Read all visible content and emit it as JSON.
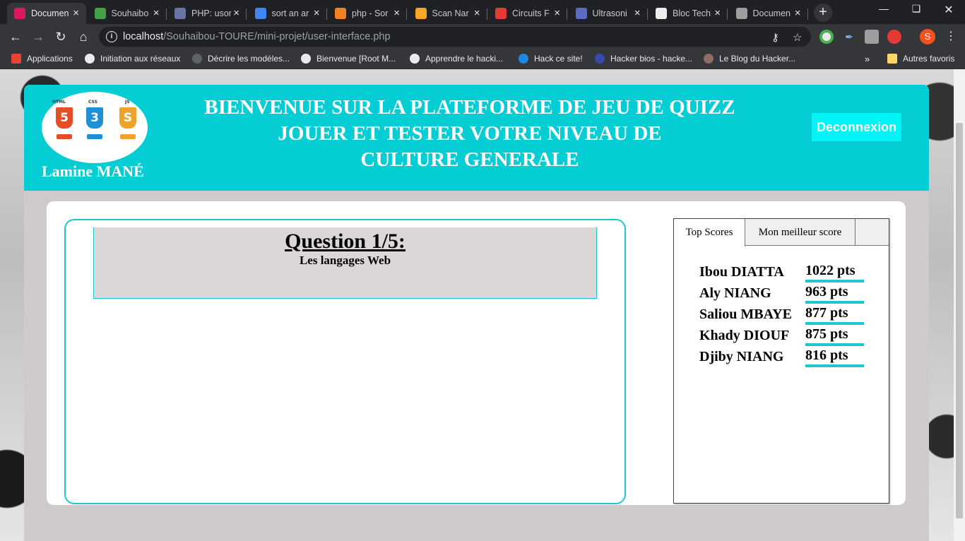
{
  "browser": {
    "tabs": [
      {
        "title": "Documen",
        "color": "#d81b60",
        "active": true
      },
      {
        "title": "Souhaibo",
        "color": "#43a047",
        "active": false
      },
      {
        "title": "PHP: usor",
        "color": "#6a74a7",
        "active": false
      },
      {
        "title": "sort an ar",
        "color": "#4285f4",
        "active": false
      },
      {
        "title": "php - Sor",
        "color": "#f48024",
        "active": false
      },
      {
        "title": "Scan Nar",
        "color": "#f9a825",
        "active": false
      },
      {
        "title": "Circuits F",
        "color": "#e53935",
        "active": false
      },
      {
        "title": "Ultrasoni",
        "color": "#5c6bc0",
        "active": false
      },
      {
        "title": "Bloc Tech",
        "color": "#eeeeee",
        "active": false
      },
      {
        "title": "Documen",
        "color": "#9e9e9e",
        "active": false
      }
    ],
    "url_host": "localhost",
    "url_path": "/Souhaibou-TOURE/mini-projet/user-interface.php",
    "profile_initial": "S",
    "bookmarks": [
      {
        "label": "Applications",
        "color": "#ea4335"
      },
      {
        "label": "Initiation aux réseaux",
        "color": "#e8eaed"
      },
      {
        "label": "Décrire les modèles...",
        "color": "#5f6368"
      },
      {
        "label": "Bienvenue [Root M...",
        "color": "#e8eaed"
      },
      {
        "label": "Apprendre le hacki...",
        "color": "#e8eaed"
      },
      {
        "label": "Hack ce site!",
        "color": "#1e88e5"
      },
      {
        "label": "Hacker bios - hacke...",
        "color": "#3949ab"
      },
      {
        "label": "Le Blog du Hacker...",
        "color": "#8d6e63"
      }
    ],
    "other_bookmarks": "Autres favoris"
  },
  "header": {
    "user_name": "Lamine MANÉ",
    "welcome_line1": "BIENVENUE SUR LA PLATEFORME DE JEU DE QUIZZ",
    "welcome_line2": "JOUER ET TESTER VOTRE NIVEAU DE CULTURE GENERALE",
    "logout_label": "Deconnexion",
    "logo_labels": [
      "HTML",
      "CSS",
      "JS"
    ],
    "logo_glyphs": [
      "5",
      "3",
      "S"
    ],
    "accent_color": "#04cdd3"
  },
  "question": {
    "title": "Question 1/5:",
    "topic": "Les langages Web"
  },
  "scores": {
    "tab_top": "Top Scores",
    "tab_mine": "Mon meilleur score",
    "top": [
      {
        "name": "Ibou DIATTA",
        "points": "1022 pts"
      },
      {
        "name": "Aly NIANG",
        "points": "963 pts"
      },
      {
        "name": "Saliou MBAYE",
        "points": "877 pts"
      },
      {
        "name": "Khady DIOUF",
        "points": "875 pts"
      },
      {
        "name": "Djiby NIANG",
        "points": "816 pts"
      }
    ]
  }
}
